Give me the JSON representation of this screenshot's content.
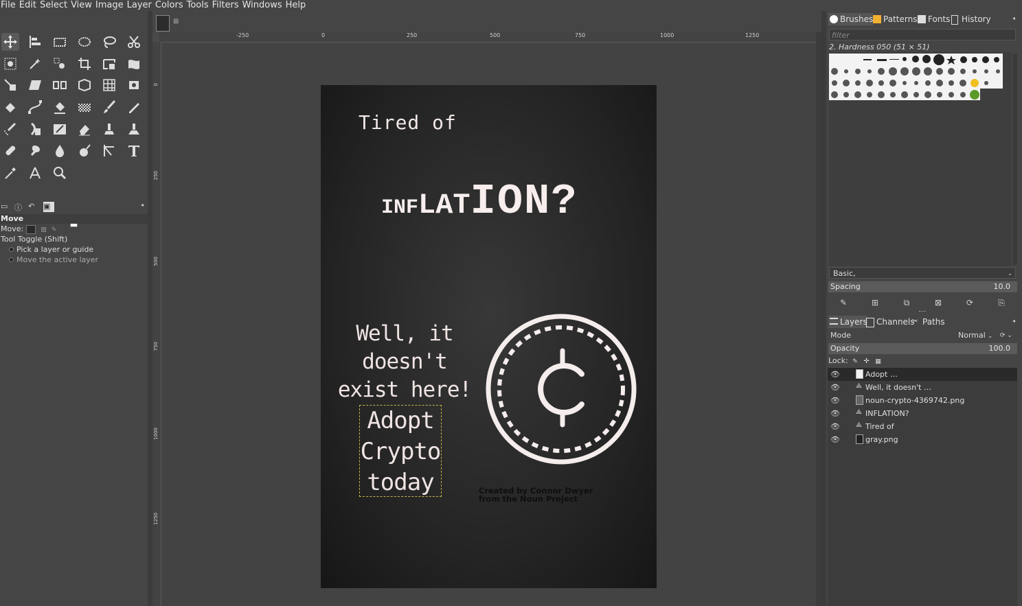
{
  "menu": [
    "File",
    "Edit",
    "Select",
    "View",
    "Image",
    "Layer",
    "Colors",
    "Tools",
    "Filters",
    "Windows",
    "Help"
  ],
  "tool_options": {
    "title": "Move",
    "move_label": "Move:",
    "toggle_label": "Tool Toggle  (Shift)",
    "opt1": "Pick a layer or guide",
    "opt2": "Move the active layer"
  },
  "ruler_h": [
    "-250",
    "0",
    "250",
    "500",
    "750",
    "1000",
    "1250"
  ],
  "ruler_v": [
    "0",
    "250",
    "500",
    "750",
    "1000",
    "1250"
  ],
  "poster": {
    "tired": "Tired of",
    "inflation_a": "INF",
    "inflation_b": "LAT",
    "inflation_c": "ION?",
    "well_line1": "Well, it doesn't",
    "well_line2": "exist here!",
    "adopt_line1": "Adopt",
    "adopt_line2": "Crypto",
    "adopt_line3": "today",
    "credit_line1": "Created by Connor Dwyer",
    "credit_line2": "from the Noun Project"
  },
  "dock_top": {
    "tabs": [
      "Brushes",
      "Patterns",
      "Fonts",
      "History"
    ],
    "filter_placeholder": "filter",
    "brush_name": "2. Hardness 050 (51 × 51)",
    "preset": "Basic,",
    "spacing_label": "Spacing",
    "spacing_value": "10.0"
  },
  "dock_bottom": {
    "tabs": [
      "Layers",
      "Channels",
      "Paths"
    ],
    "mode_label": "Mode",
    "mode_value": "Normal",
    "opacity_label": "Opacity",
    "opacity_value": "100.0",
    "lock_label": "Lock:",
    "layers": [
      "Adopt …",
      "Well, it doesn't …",
      "noun-crypto-4369742.png",
      "INFLATION?",
      "Tired of",
      "gray.png"
    ]
  },
  "colors": {
    "accent": "#f7eeed",
    "selection": "#c8b84a"
  }
}
